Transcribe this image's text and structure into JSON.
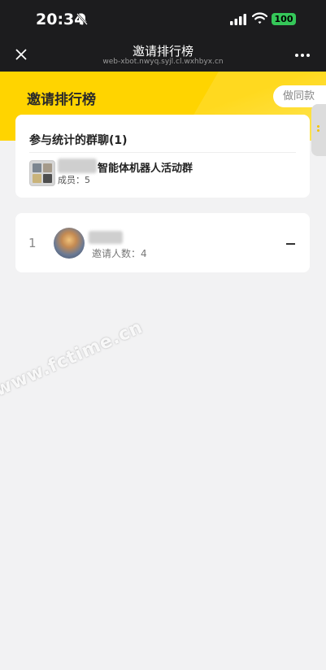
{
  "status_bar": {
    "time": "20:34",
    "battery": "100",
    "battery_color": "#35c759"
  },
  "nav": {
    "title": "邀请排行榜",
    "url": "web-xbot.nwyq.syjl.cl.wxhbyx.cn",
    "icons": [
      "close-icon",
      "more-icon"
    ]
  },
  "banner": {
    "title": "邀请排行榜",
    "same_style_label": "做同款",
    "accent": "#ffd400"
  },
  "groups_card": {
    "title": "参与统计的群聊(1)",
    "group": {
      "name": "智能体机器人活动群",
      "members": "成员：5"
    }
  },
  "ranking": [
    {
      "rank": "1",
      "invite_count": "邀请人数：4",
      "trend": "–"
    }
  ],
  "watermark": "www.fctime.cn"
}
